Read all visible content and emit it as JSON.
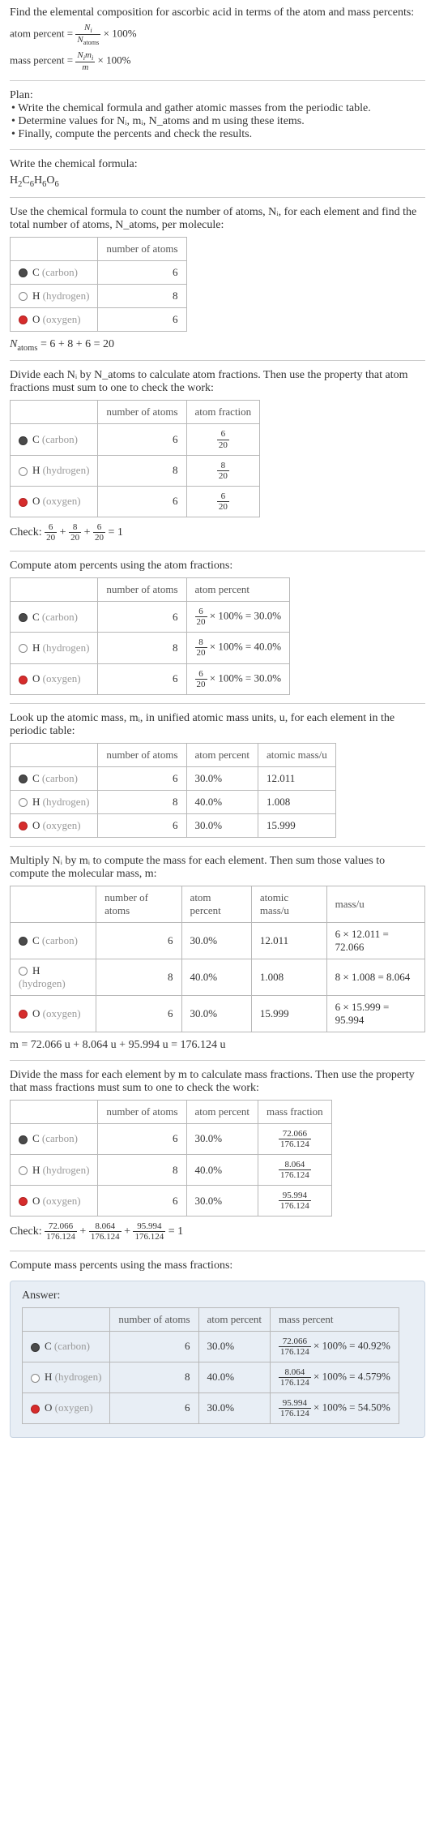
{
  "intro": "Find the elemental composition for ascorbic acid in terms of the atom and mass percents:",
  "atom_percent_formula": "atom percent = Nᵢ / N_atoms × 100%",
  "mass_percent_formula": "mass percent = Nᵢmᵢ / m × 100%",
  "plan_label": "Plan:",
  "plan": [
    "• Write the chemical formula and gather atomic masses from the periodic table.",
    "• Determine values for Nᵢ, mᵢ, N_atoms and m using these items.",
    "• Finally, compute the percents and check the results."
  ],
  "write_formula_label": "Write the chemical formula:",
  "chem_formula": "H₂C₆H₆O₆",
  "count_intro": "Use the chemical formula to count the number of atoms, Nᵢ, for each element and find the total number of atoms, N_atoms, per molecule:",
  "elements": {
    "c": {
      "name": "C",
      "sub": "(carbon)",
      "dot": "carbon"
    },
    "h": {
      "name": "H",
      "sub": "(hydrogen)",
      "dot": "hydrogen"
    },
    "o": {
      "name": "O",
      "sub": "(oxygen)",
      "dot": "oxygen"
    }
  },
  "t1": {
    "h1": "",
    "h2": "number of atoms",
    "c": "6",
    "h": "8",
    "o": "6"
  },
  "natoms": "N_atoms = 6 + 8 + 6 = 20",
  "divide_intro": "Divide each Nᵢ by N_atoms to calculate atom fractions. Then use the property that atom fractions must sum to one to check the work:",
  "t2": {
    "h1": "number of atoms",
    "h2": "atom fraction",
    "c": "6",
    "cf": {
      "n": "6",
      "d": "20"
    },
    "h": "8",
    "hf": {
      "n": "8",
      "d": "20"
    },
    "o": "6",
    "of": {
      "n": "6",
      "d": "20"
    }
  },
  "check1": "Check: 6/20 + 8/20 + 6/20 = 1",
  "atom_percent_intro": "Compute atom percents using the atom fractions:",
  "t3": {
    "h1": "number of atoms",
    "h2": "atom percent",
    "c": "6",
    "cp": "6/20 × 100% = 30.0%",
    "h": "8",
    "hp": "8/20 × 100% = 40.0%",
    "o": "6",
    "op": "6/20 × 100% = 30.0%"
  },
  "mass_intro": "Look up the atomic mass, mᵢ, in unified atomic mass units, u, for each element in the periodic table:",
  "t4": {
    "h1": "number of atoms",
    "h2": "atom percent",
    "h3": "atomic mass/u",
    "c": [
      "6",
      "30.0%",
      "12.011"
    ],
    "h": [
      "8",
      "40.0%",
      "1.008"
    ],
    "o": [
      "6",
      "30.0%",
      "15.999"
    ]
  },
  "mult_intro": "Multiply Nᵢ by mᵢ to compute the mass for each element. Then sum those values to compute the molecular mass, m:",
  "t5": {
    "h1": "number of atoms",
    "h2": "atom percent",
    "h3": "atomic mass/u",
    "h4": "mass/u",
    "c": [
      "6",
      "30.0%",
      "12.011",
      "6 × 12.011 = 72.066"
    ],
    "h": [
      "8",
      "40.0%",
      "1.008",
      "8 × 1.008 = 8.064"
    ],
    "o": [
      "6",
      "30.0%",
      "15.999",
      "6 × 15.999 = 95.994"
    ]
  },
  "m_total": "m = 72.066 u + 8.064 u + 95.994 u = 176.124 u",
  "massfrac_intro": "Divide the mass for each element by m to calculate mass fractions. Then use the property that mass fractions must sum to one to check the work:",
  "t6": {
    "h1": "number of atoms",
    "h2": "atom percent",
    "h3": "mass fraction",
    "c": [
      "6",
      "30.0%"
    ],
    "cf": {
      "n": "72.066",
      "d": "176.124"
    },
    "h": [
      "8",
      "40.0%"
    ],
    "hf": {
      "n": "8.064",
      "d": "176.124"
    },
    "o": [
      "6",
      "30.0%"
    ],
    "of": {
      "n": "95.994",
      "d": "176.124"
    }
  },
  "check2": "Check: 72.066/176.124 + 8.064/176.124 + 95.994/176.124 = 1",
  "final_intro": "Compute mass percents using the mass fractions:",
  "answer_label": "Answer:",
  "t7": {
    "h1": "number of atoms",
    "h2": "atom percent",
    "h3": "mass percent",
    "c": [
      "6",
      "30.0%",
      "72.066/176.124 × 100% = 40.92%"
    ],
    "h": [
      "8",
      "40.0%",
      "8.064/176.124 × 100% = 4.579%"
    ],
    "o": [
      "6",
      "30.0%",
      "95.994/176.124 × 100% = 54.50%"
    ]
  }
}
